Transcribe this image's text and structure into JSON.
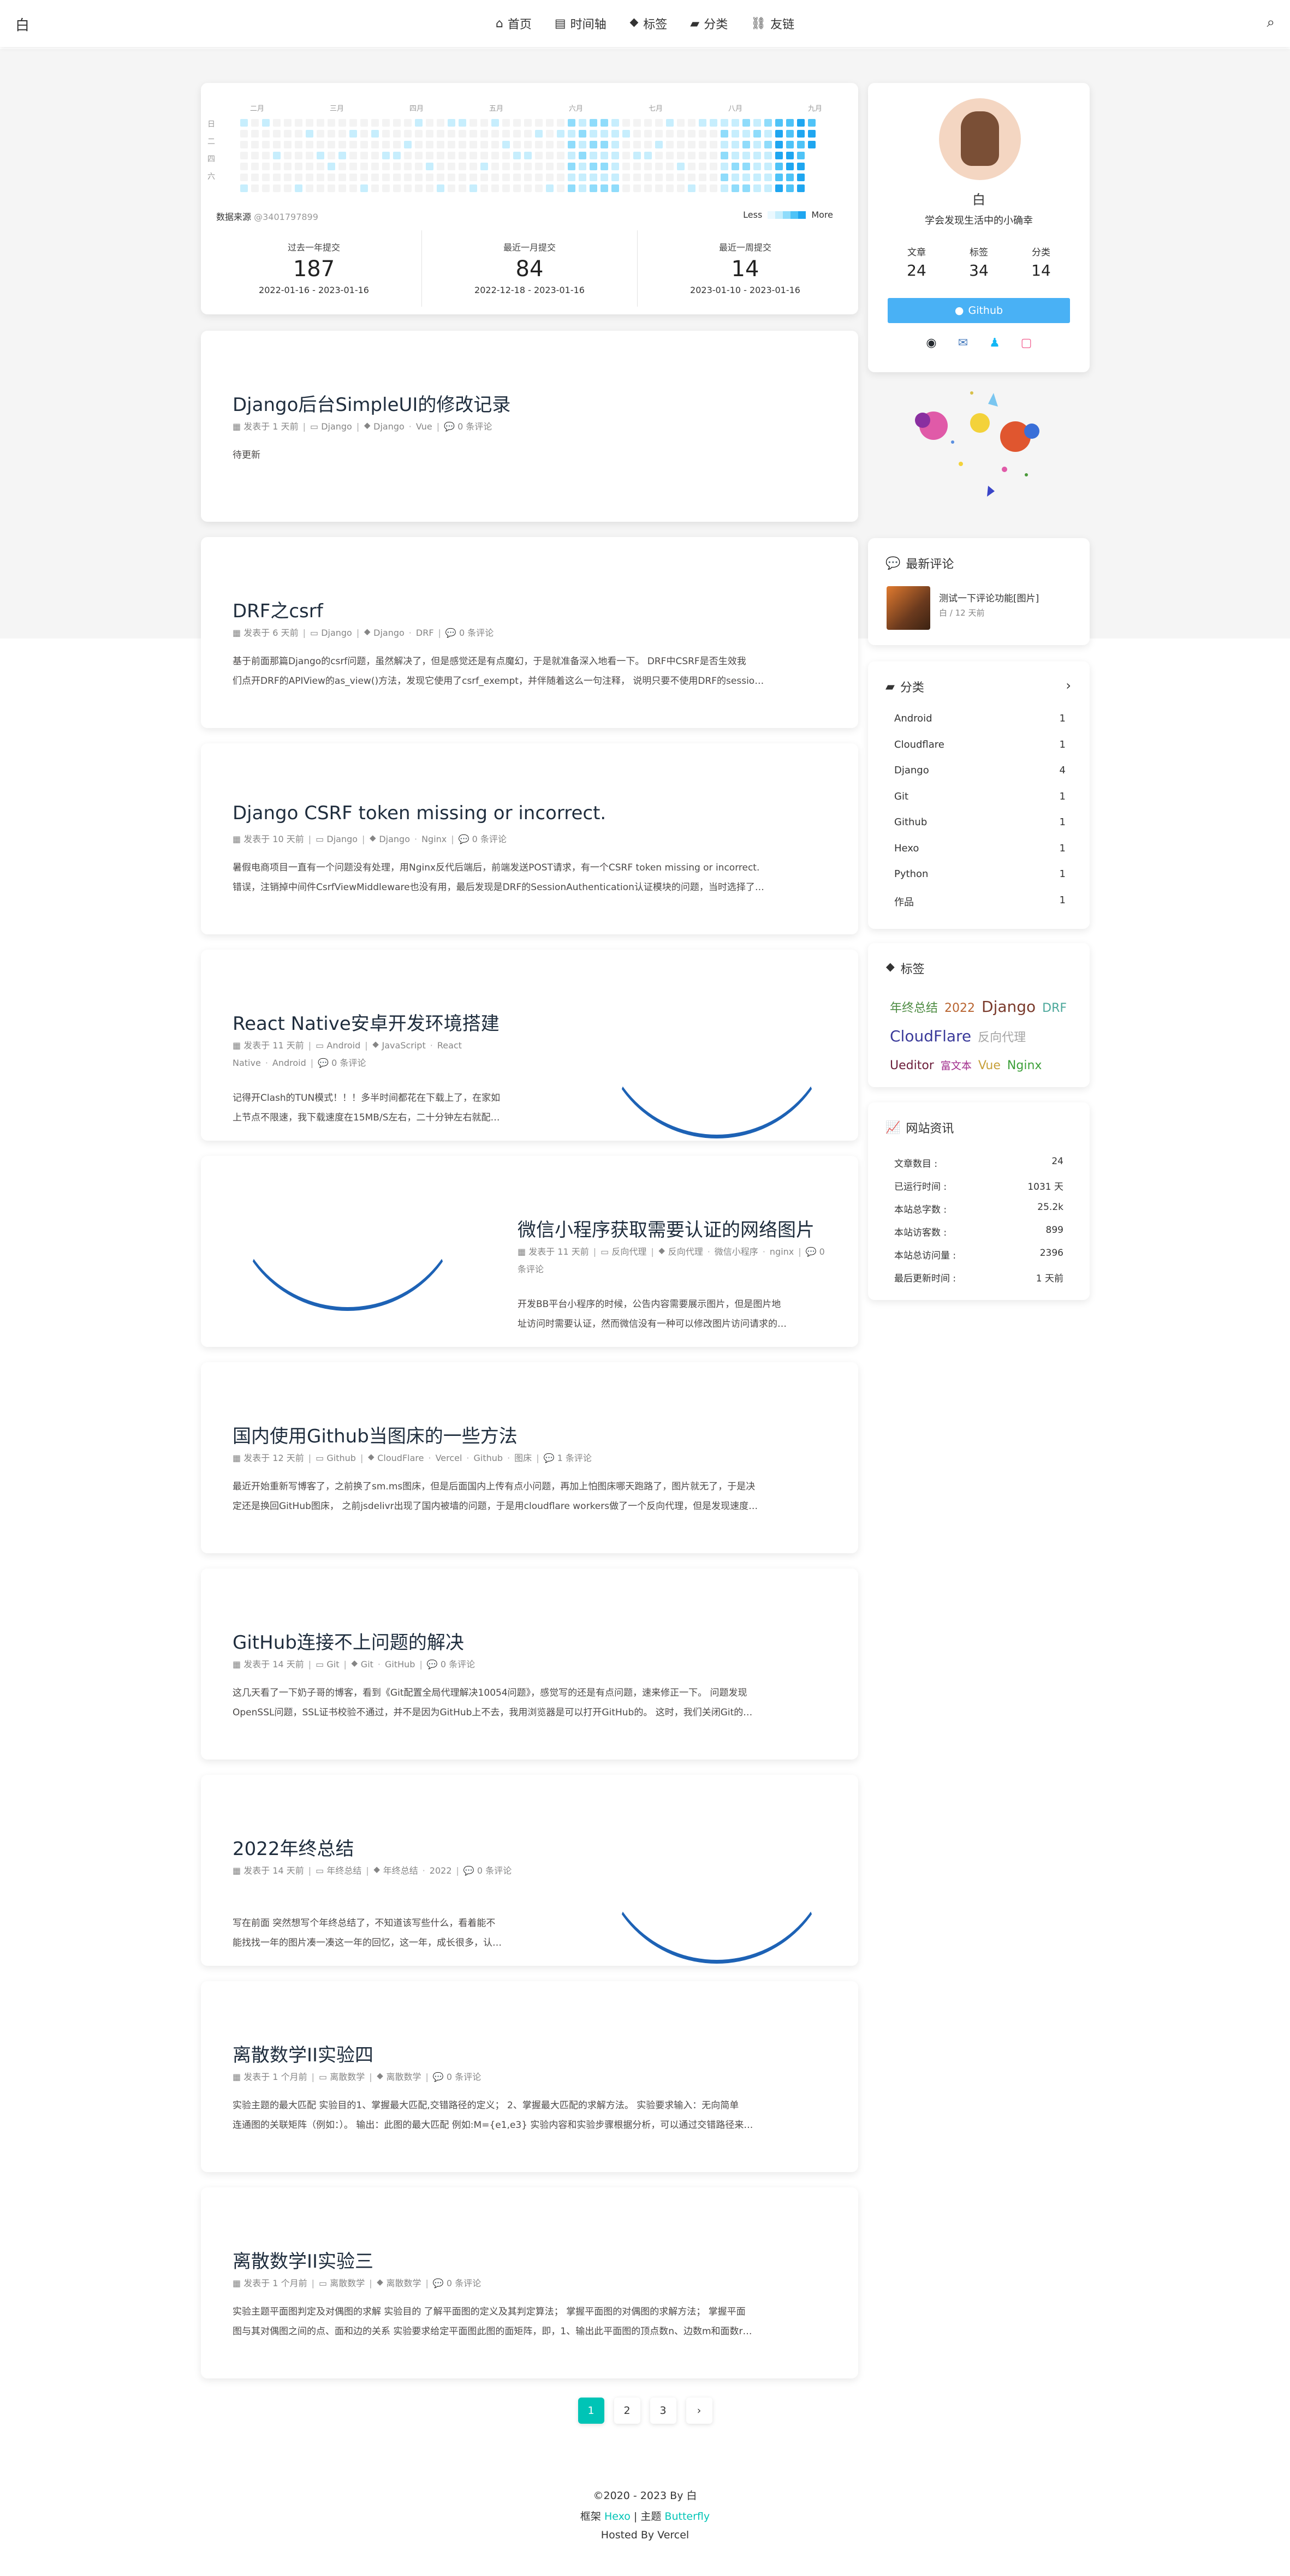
{
  "nav": {
    "logo": "白",
    "items": [
      {
        "icon": "home-icon",
        "glyph": "⌂",
        "label": "首页"
      },
      {
        "icon": "archive-icon",
        "glyph": "▤",
        "label": "时间轴"
      },
      {
        "icon": "tag-icon",
        "glyph": "⯁",
        "label": "标签"
      },
      {
        "icon": "folder-icon",
        "glyph": "▰",
        "label": "分类"
      },
      {
        "icon": "link-icon",
        "glyph": "⛓",
        "label": "友链"
      }
    ],
    "search_icon": "search-icon"
  },
  "contrib": {
    "months": [
      "二月",
      "三月",
      "四月",
      "五月",
      "六月",
      "七月",
      "八月",
      "九月"
    ],
    "weekdays": [
      "日",
      "二",
      "四",
      "六"
    ],
    "source_label": "数据来源",
    "source_id": "@3401797899",
    "less": "Less",
    "more": "More",
    "colors": [
      "#ebf9ff",
      "#c7eefd",
      "#8fdcfb",
      "#4fc3f7",
      "#1fa6f0"
    ],
    "stats": [
      {
        "label": "过去一年提交",
        "value": "187",
        "range": "2022-01-16 - 2023-01-16"
      },
      {
        "label": "最近一月提交",
        "value": "84",
        "range": "2022-12-18 - 2023-01-16"
      },
      {
        "label": "最近一周提交",
        "value": "14",
        "range": "2023-01-10 - 2023-01-16"
      }
    ]
  },
  "posts": [
    {
      "title": "Django后台SimpleUI的修改记录",
      "date": "发表于 1 天前",
      "cat": "Django",
      "tags": [
        "Django",
        "Vue"
      ],
      "comments": "0 条评论",
      "excerpt": [
        "待更新"
      ]
    },
    {
      "title": "DRF之csrf",
      "date": "发表于 6 天前",
      "cat": "Django",
      "tags": [
        "Django",
        "DRF"
      ],
      "comments": "0 条评论",
      "excerpt": [
        "基于前面那篇Django的csrf问题，虽然解决了，但是感觉还是有点魔幻，于是就准备深入地看一下。 DRF中CSRF是否生效我",
        "们点开DRF的APIView的as_view()方法，发现它使用了csrf_exempt，并伴随着这么一句注释， 说明只要不使用DRF的sessio…"
      ]
    },
    {
      "title": "Django CSRF token missing or incorrect.",
      "date": "发表于 10 天前",
      "cat": "Django",
      "tags": [
        "Django",
        "Nginx"
      ],
      "comments": "0 条评论",
      "excerpt": [
        "暑假电商项目一直有一个问题没有处理，用Nginx反代后端后，前端发送POST请求，有一个CSRF token missing or incorrect.",
        "错误，注销掉中间件CsrfViewMiddleware也没有用，最后发现是DRF的SessionAuthentication认证模块的问题，当时选择了…"
      ]
    },
    {
      "title": "React Native安卓开发环境搭建",
      "date": "发表于 11 天前",
      "cat": "Android",
      "tags": [
        "JavaScript",
        "React Native",
        "Android"
      ],
      "comments": "0 条评论",
      "excerpt": [
        "记得开Clash的TUN模式！！！多半时间都花在下载上了，在家如",
        "上节点不限速，我下载速度在15MB/S左右，二十分钟左右就配…"
      ]
    },
    {
      "title": "微信小程序获取需要认证的网络图片",
      "date": "发表于 11 天前",
      "cat": "反向代理",
      "tags": [
        "反向代理",
        "微信小程序",
        "nginx"
      ],
      "comments": "0 条评论",
      "excerpt": [
        "开发BB平台小程序的时候，公告内容需要展示图片，但是图片地",
        "址访问时需要认证，然而微信没有一种可以修改图片访问请求的…"
      ]
    },
    {
      "title": "国内使用Github当图床的一些方法",
      "date": "发表于 12 天前",
      "cat": "Github",
      "tags": [
        "CloudFlare",
        "Vercel",
        "Github",
        "图床"
      ],
      "comments": "1 条评论",
      "excerpt": [
        "最近开始重新写博客了，之前换了sm.ms图床，但是后面国内上传有点小问题，再加上怕图床哪天跑路了，图片就无了，于是决",
        "定还是换回GitHub图床， 之前jsdelivr出现了国内被墙的问题，于是用cloudflare workers做了一个反向代理，但是发现速度…"
      ]
    },
    {
      "title": "GitHub连接不上问题的解决",
      "date": "发表于 14 天前",
      "cat": "Git",
      "tags": [
        "Git",
        "GitHub"
      ],
      "comments": "0 条评论",
      "excerpt": [
        "这几天看了一下奶子哥的博客，看到《Git配置全局代理解决10054问题》，感觉写的还是有点问题，速来修正一下。 问题发现",
        "OpenSSL问题，SSL证书校验不通过，并不是因为GitHub上不去，我用浏览器是可以打开GitHub的。 这时，我们关闭Git的…"
      ]
    },
    {
      "title": "2022年终总结",
      "date": "发表于 14 天前",
      "cat": "年终总结",
      "tags": [
        "年终总结",
        "2022"
      ],
      "comments": "0 条评论",
      "excerpt": [
        "写在前面 突然想写个年终总结了，不知道该写些什么，看着能不",
        "能找找一年的图片凑一凑这一年的回忆，这一年，成长很多，认…"
      ]
    },
    {
      "title": "离散数学II实验四",
      "date": "发表于 1 个月前",
      "cat": "离散数学",
      "tags": [
        "离散数学"
      ],
      "comments": "0 条评论",
      "excerpt": [
        "实验主题的最大匹配 实验目的1、掌握最大匹配,交错路径的定义； 2、掌握最大匹配的求解方法。 实验要求输入：无向简单",
        "连通图的关联矩阵（例如：）。 输出：此图的最大匹配 例如:M={e1,e3} 实验内容和实验步骤根据分析，可以通过交错路径来…"
      ]
    },
    {
      "title": "离散数学II实验三",
      "date": "发表于 1 个月前",
      "cat": "离散数学",
      "tags": [
        "离散数学"
      ],
      "comments": "0 条评论",
      "excerpt": [
        "实验主题平面图判定及对偶图的求解 实验目的 了解平面图的定义及其判定算法； 掌握平面图的对偶图的求解方法； 掌握平面",
        "图与其对偶图之间的点、面和边的关系 实验要求给定平面图此图的面矩阵，即，1、输出此平面图的顶点数n、边数m和面数r…"
      ]
    }
  ],
  "author": {
    "name": "白",
    "desc": "学会发现生活中的小确幸",
    "counts": [
      {
        "label": "文章",
        "value": "24"
      },
      {
        "label": "标签",
        "value": "34"
      },
      {
        "label": "分类",
        "value": "14"
      }
    ],
    "github_label": "Github"
  },
  "comments": {
    "title": "最新评论",
    "item_text": "测试一下评论功能[图片]",
    "item_meta": "白 / 12 天前"
  },
  "categories": {
    "title": "分类",
    "items": [
      {
        "name": "Android",
        "count": "1"
      },
      {
        "name": "Cloudflare",
        "count": "1"
      },
      {
        "name": "Django",
        "count": "4"
      },
      {
        "name": "Git",
        "count": "1"
      },
      {
        "name": "Github",
        "count": "1"
      },
      {
        "name": "Hexo",
        "count": "1"
      },
      {
        "name": "Python",
        "count": "1"
      },
      {
        "name": "作品",
        "count": "1"
      }
    ]
  },
  "tags": {
    "title": "标签",
    "items": [
      {
        "name": "年终总结",
        "color": "#4e8c43",
        "size": "M"
      },
      {
        "name": "2022",
        "color": "#b8632f",
        "size": "M"
      },
      {
        "name": "Django",
        "color": "#7a3a2b",
        "size": "L"
      },
      {
        "name": "DRF",
        "color": "#4aa79a",
        "size": "M"
      },
      {
        "name": "CloudFlare",
        "color": "#3a3a9a",
        "size": "L"
      },
      {
        "name": "反向代理",
        "color": "#a5a5a5",
        "size": "M"
      },
      {
        "name": "Ueditor",
        "color": "#6b1d3a",
        "size": "M"
      },
      {
        "name": "富文本",
        "color": "#a12d8c",
        "size": "S"
      },
      {
        "name": "Vue",
        "color": "#c7a03a",
        "size": "M"
      },
      {
        "name": "Nginx",
        "color": "#3da03a",
        "size": "M"
      }
    ]
  },
  "siteinfo": {
    "title": "网站资讯",
    "rows": [
      {
        "k": "文章数目 :",
        "v": "24"
      },
      {
        "k": "已运行时间 :",
        "v": "1031 天"
      },
      {
        "k": "本站总字数 :",
        "v": "25.2k"
      },
      {
        "k": "本站访客数 :",
        "v": "899"
      },
      {
        "k": "本站总访问量 :",
        "v": "2396"
      },
      {
        "k": "最后更新时间 :",
        "v": "1 天前"
      }
    ]
  },
  "pager": [
    "1",
    "2",
    "3",
    "›"
  ],
  "footer": {
    "line1": "©2020 - 2023 By 白",
    "frame_prefix": "框架",
    "frame": "Hexo",
    "theme_prefix": "| 主题",
    "theme": "Butterfly",
    "hosted": "Hosted By Vercel"
  }
}
